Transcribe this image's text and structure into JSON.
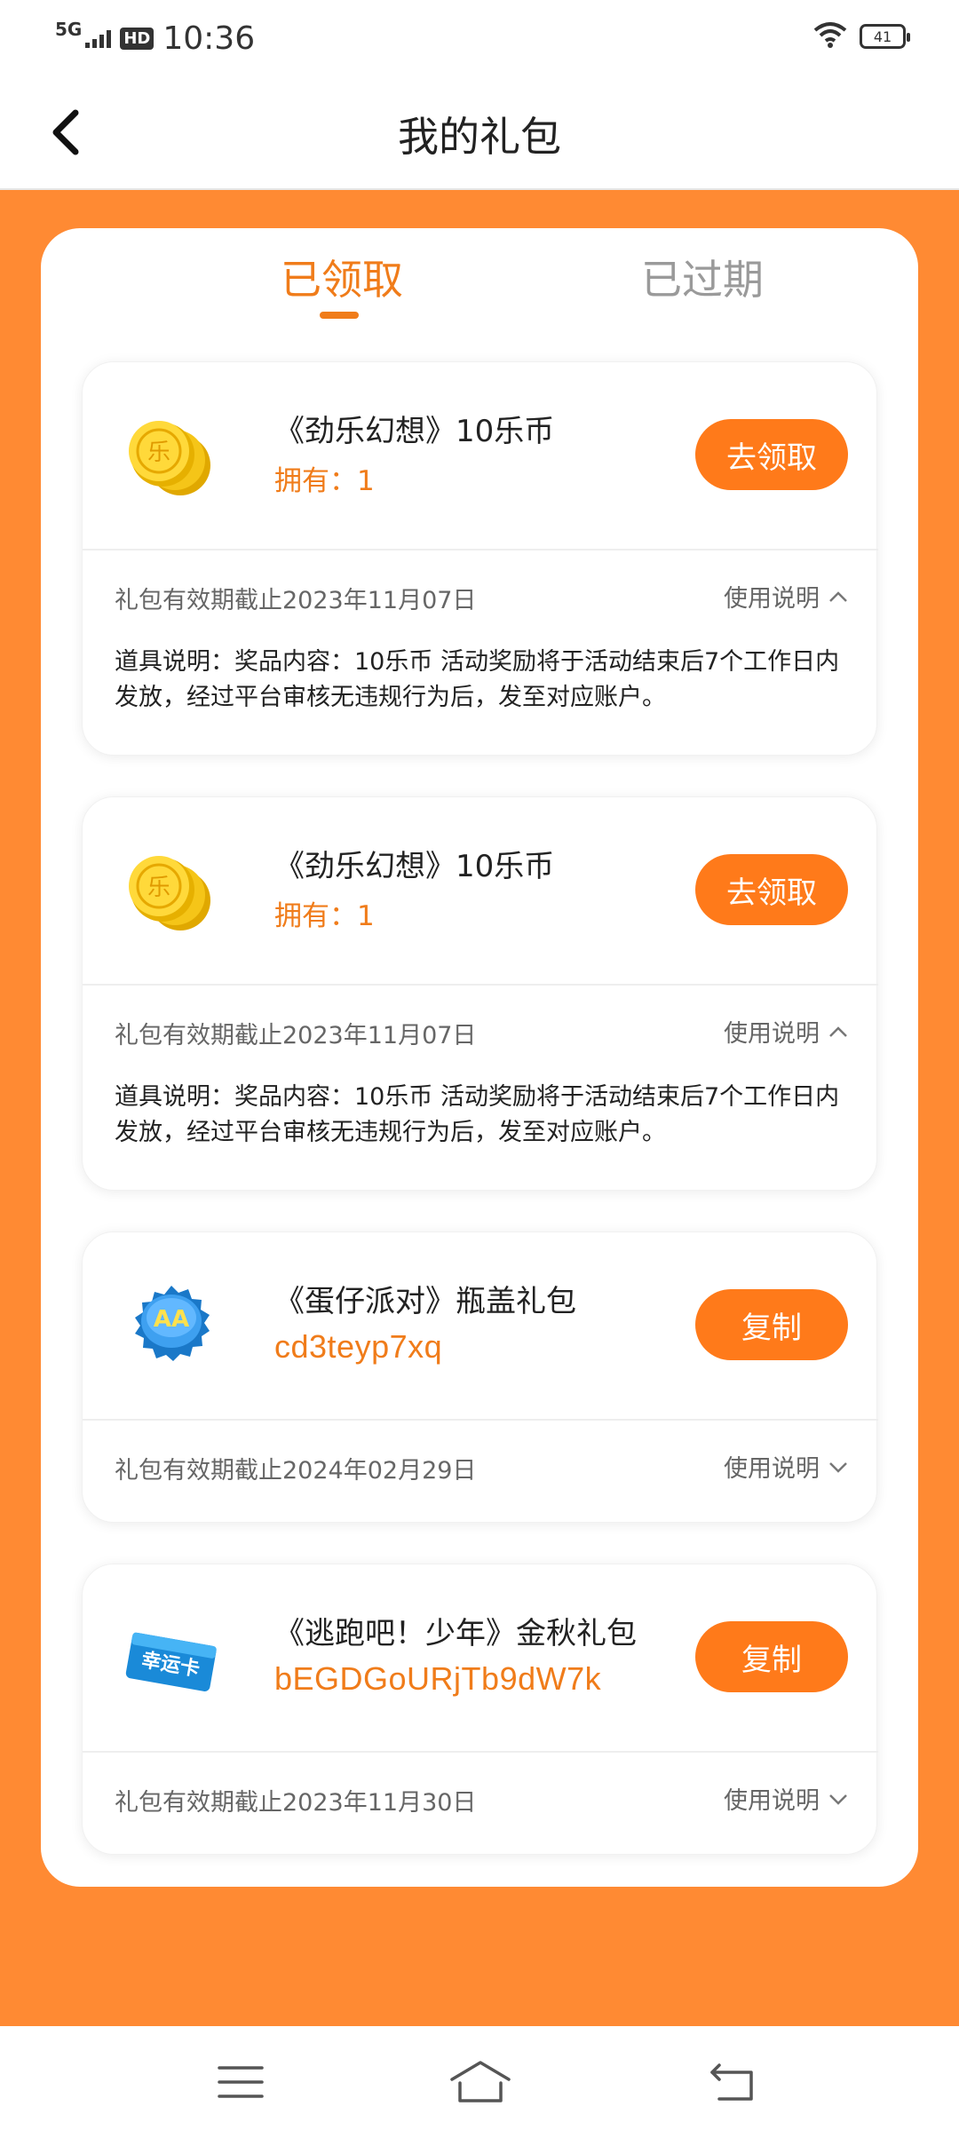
{
  "status_bar": {
    "network": "5G",
    "hd": "HD",
    "time": "10:36",
    "battery": "41"
  },
  "header": {
    "title": "我的礼包"
  },
  "tabs": [
    {
      "label": "已领取",
      "active": true
    },
    {
      "label": "已过期",
      "active": false
    }
  ],
  "colors": {
    "accent": "#ff7a1a",
    "tab_active": "#f07c1a",
    "background": "#ff8a33"
  },
  "gifts": [
    {
      "icon": "coin-stack-icon",
      "name": "《劲乐幻想》10乐币",
      "sub": "拥有：1",
      "button": "去领取",
      "expiry": "礼包有效期截止2023年11月07日",
      "usage_label": "使用说明",
      "expanded": true,
      "description": "道具说明：奖品内容：10乐币 活动奖励将于活动结束后7个工作日内发放，经过平台审核无违规行为后，发至对应账户。"
    },
    {
      "icon": "coin-stack-icon",
      "name": "《劲乐幻想》10乐币",
      "sub": "拥有：1",
      "button": "去领取",
      "expiry": "礼包有效期截止2023年11月07日",
      "usage_label": "使用说明",
      "expanded": true,
      "description": "道具说明：奖品内容：10乐币 活动奖励将于活动结束后7个工作日内发放，经过平台审核无违规行为后，发至对应账户。"
    },
    {
      "icon": "bottle-cap-icon",
      "name": "《蛋仔派对》瓶盖礼包",
      "sub": "cd3teyp7xq",
      "button": "复制",
      "expiry": "礼包有效期截止2024年02月29日",
      "usage_label": "使用说明",
      "expanded": false
    },
    {
      "icon": "lucky-card-icon",
      "icon_text": "幸运卡",
      "name": "《逃跑吧！少年》金秋礼包",
      "sub": "bEGDGoURjTb9dW7k",
      "button": "复制",
      "expiry": "礼包有效期截止2023年11月30日",
      "usage_label": "使用说明",
      "expanded": false
    }
  ]
}
